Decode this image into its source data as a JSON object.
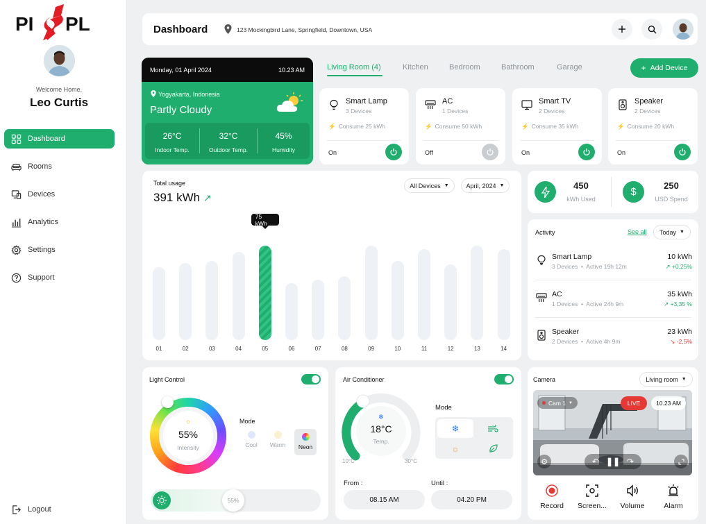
{
  "brand": {
    "logo_text": "PISPL"
  },
  "user": {
    "welcome": "Welcome Home,",
    "name": "Leo Curtis"
  },
  "nav": {
    "items": [
      {
        "label": "Dashboard",
        "icon": "grid-icon"
      },
      {
        "label": "Rooms",
        "icon": "sofa-icon"
      },
      {
        "label": "Devices",
        "icon": "devices-icon"
      },
      {
        "label": "Analytics",
        "icon": "bar-chart-icon"
      },
      {
        "label": "Settings",
        "icon": "gear-icon"
      },
      {
        "label": "Support",
        "icon": "help-icon"
      }
    ],
    "logout": "Logout"
  },
  "header": {
    "title": "Dashboard",
    "address": "123 Mockingbird Lane, Springfield, Downtown, USA"
  },
  "weather": {
    "date": "Monday, 01 April 2024",
    "time": "10.23 AM",
    "location": "Yogyakarta, Indonesia",
    "condition": "Partly Cloudy",
    "stats": [
      {
        "value": "26°C",
        "label": "Indoor Temp."
      },
      {
        "value": "32°C",
        "label": "Outdoor Temp."
      },
      {
        "value": "45%",
        "label": "Humidity"
      }
    ]
  },
  "rooms": {
    "tabs": [
      "Living Room (4)",
      "Kitchen",
      "Bedroom",
      "Bathroom",
      "Garage"
    ],
    "add_device": "Add Device"
  },
  "devices": [
    {
      "name": "Smart Lamp",
      "count": "3 Devices",
      "consume": "Consume 25 kWh",
      "status": "On",
      "on": true
    },
    {
      "name": "AC",
      "count": "1 Devices",
      "consume": "Consume 50 kWh",
      "status": "Off",
      "on": false
    },
    {
      "name": "Smart TV",
      "count": "2 Devices",
      "consume": "Consume 35 kWh",
      "status": "On",
      "on": true
    },
    {
      "name": "Speaker",
      "count": "2 Devices",
      "consume": "Consume 20 kWh",
      "status": "On",
      "on": true
    }
  ],
  "usage": {
    "label": "Total usage",
    "total": "391 kWh",
    "filter_devices": "All Devices",
    "filter_month": "April, 2024",
    "tooltip": "75 kWh"
  },
  "chart_data": {
    "type": "bar",
    "categories": [
      "01",
      "02",
      "03",
      "04",
      "05",
      "06",
      "07",
      "08",
      "09",
      "10",
      "11",
      "12",
      "13",
      "14"
    ],
    "values": [
      58,
      61,
      63,
      70,
      75,
      45,
      48,
      51,
      75,
      63,
      72,
      60,
      75,
      72
    ],
    "highlight": "05",
    "ylim": [
      0,
      80
    ],
    "title": "Total usage",
    "xlabel": "",
    "ylabel": ""
  },
  "energy": {
    "kwh": "450",
    "kwh_label": "kWh Used",
    "usd": "250",
    "usd_label": "USD Spend"
  },
  "activity": {
    "title": "Activity",
    "see_all": "See all",
    "period": "Today",
    "rows": [
      {
        "name": "Smart Lamp",
        "devices": "3 Devices",
        "active": "Active 19h 12m",
        "kwh": "10 kWh",
        "delta": "+0,25%",
        "up": true
      },
      {
        "name": "AC",
        "devices": "1 Devices",
        "active": "Active 24h 9m",
        "kwh": "35 kWh",
        "delta": "+3,35 %",
        "up": true
      },
      {
        "name": "Speaker",
        "devices": "2 Devices",
        "active": "Active 4h 9m",
        "kwh": "23 kWh",
        "delta": "-2,5%",
        "up": false
      }
    ]
  },
  "light": {
    "title": "Light Control",
    "intensity": "55%",
    "intensity_label": "Intensity",
    "mode_label": "Mode",
    "modes": [
      "Cool",
      "Warm",
      "Neon"
    ],
    "slider_value": "55%",
    "slider_level": 0.55
  },
  "ac": {
    "title": "Air Conditioner",
    "temp": "18°C",
    "temp_label": "Temp.",
    "min": "10°C",
    "max": "30°C",
    "mode_label": "Mode",
    "from_label": "From :",
    "from_value": "08.15 AM",
    "until_label": "Until :",
    "until_value": "04.20 PM"
  },
  "camera": {
    "title": "Camera",
    "room": "Living room",
    "cam": "Cam 1",
    "live": "LIVE",
    "time": "10.23 AM",
    "tools": [
      "Record",
      "Screen...",
      "Volume",
      "Alarm"
    ]
  },
  "colors": {
    "accent": "#1fae6e",
    "live": "#e53935",
    "negative": "#e53935"
  }
}
